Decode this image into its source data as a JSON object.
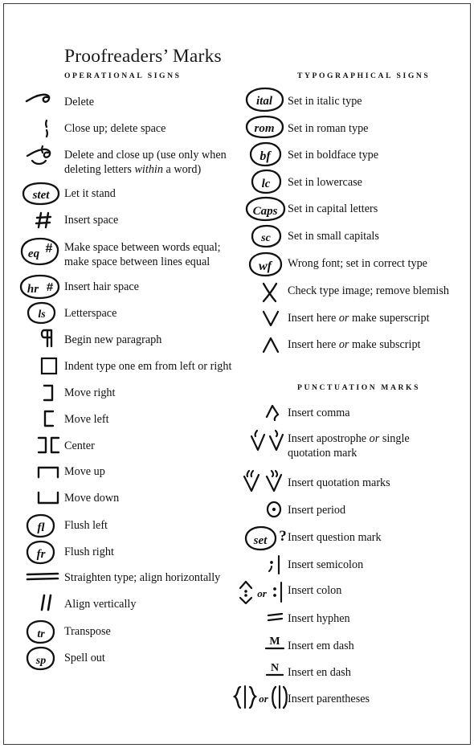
{
  "page": {
    "title": "Proofreaders’ Marks"
  },
  "sections": {
    "operational": {
      "heading": "OPERATIONAL SIGNS",
      "entries": [
        {
          "mark": "delete-dele-mark",
          "label": "Delete"
        },
        {
          "mark": "close-up-mark",
          "label": "Close up; delete space"
        },
        {
          "mark": "delete-and-close-up-mark",
          "label": "Delete and close up (use only when deleting letters <em>within</em> a word)"
        },
        {
          "mark": "stet-mark",
          "label": "Let it stand"
        },
        {
          "mark": "insert-space-mark",
          "label": "Insert space"
        },
        {
          "mark": "equal-space-mark",
          "label": "Make space between words equal; make space between lines equal"
        },
        {
          "mark": "hair-space-mark",
          "label": "Insert hair space"
        },
        {
          "mark": "letterspace-mark",
          "label": "Letterspace"
        },
        {
          "mark": "new-paragraph-mark",
          "label": "Begin new paragraph"
        },
        {
          "mark": "indent-em-mark",
          "label": "Indent type one em from left or right"
        },
        {
          "mark": "move-right-mark",
          "label": "Move right"
        },
        {
          "mark": "move-left-mark",
          "label": "Move left"
        },
        {
          "mark": "center-mark",
          "label": "Center"
        },
        {
          "mark": "move-up-mark",
          "label": "Move up"
        },
        {
          "mark": "move-down-mark",
          "label": "Move down"
        },
        {
          "mark": "flush-left-mark",
          "label": "Flush left"
        },
        {
          "mark": "flush-right-mark",
          "label": "Flush right"
        },
        {
          "mark": "straighten-type-mark",
          "label": "Straighten type; align horizontally"
        },
        {
          "mark": "align-vertically-mark",
          "label": "Align vertically"
        },
        {
          "mark": "transpose-mark",
          "label": "Transpose"
        },
        {
          "mark": "spell-out-mark",
          "label": "Spell out"
        }
      ]
    },
    "typographical": {
      "heading": "TYPOGRAPHICAL SIGNS",
      "entries": [
        {
          "mark": "italic-mark",
          "label": "Set in italic type"
        },
        {
          "mark": "roman-mark",
          "label": "Set in roman type"
        },
        {
          "mark": "boldface-mark",
          "label": "Set in boldface type"
        },
        {
          "mark": "lowercase-mark",
          "label": "Set in lowercase"
        },
        {
          "mark": "capital-letters-mark",
          "label": "Set in capital letters"
        },
        {
          "mark": "small-capitals-mark",
          "label": "Set in small capitals"
        },
        {
          "mark": "wrong-font-mark",
          "label": "Wrong font; set in correct type"
        },
        {
          "mark": "check-type-image-mark",
          "label": "Check type image; remove blemish"
        },
        {
          "mark": "superscript-caret-mark",
          "label": "Insert here <em>or</em> make superscript"
        },
        {
          "mark": "subscript-caret-mark",
          "label": "Insert here <em>or</em> make subscript"
        }
      ]
    },
    "punctuation": {
      "heading": "PUNCTUATION MARKS",
      "entries": [
        {
          "mark": "insert-comma-mark",
          "label": "Insert comma"
        },
        {
          "mark": "insert-apostrophe-mark",
          "label": "Insert apostrophe <em>or</em> single quotation mark"
        },
        {
          "mark": "insert-quotation-mark",
          "label": "Insert quotation marks"
        },
        {
          "mark": "insert-period-mark",
          "label": "Insert period"
        },
        {
          "mark": "insert-question-mark",
          "label": "Insert question mark"
        },
        {
          "mark": "insert-semicolon-mark",
          "label": "Insert semicolon"
        },
        {
          "mark": "insert-colon-mark",
          "label": "Insert colon"
        },
        {
          "mark": "insert-hyphen-mark",
          "label": "Insert hyphen"
        },
        {
          "mark": "insert-em-dash-mark",
          "label": "Insert em dash"
        },
        {
          "mark": "insert-en-dash-mark",
          "label": "Insert en dash"
        },
        {
          "mark": "insert-parentheses-mark",
          "label": "Insert parentheses"
        }
      ]
    }
  },
  "mark_glyph_text": {
    "stet": "stet",
    "equal_space": "eq",
    "hair_space": "hr",
    "letterspace": "ls",
    "flush_left": "fl",
    "flush_right": "fr",
    "transpose": "tr",
    "spell_out": "sp",
    "italic": "ital",
    "roman": "rom",
    "boldface": "bf",
    "lowercase": "lc",
    "capitals": "Caps",
    "small_capitals": "sc",
    "wrong_font": "wf",
    "set_question": "set",
    "em_dash": "M",
    "en_dash": "N",
    "or_word": "or",
    "sharp": "#",
    "question": "?"
  },
  "colors": {
    "ink": "#121212",
    "border": "#3b3b3f",
    "paper": "#ffffff"
  }
}
